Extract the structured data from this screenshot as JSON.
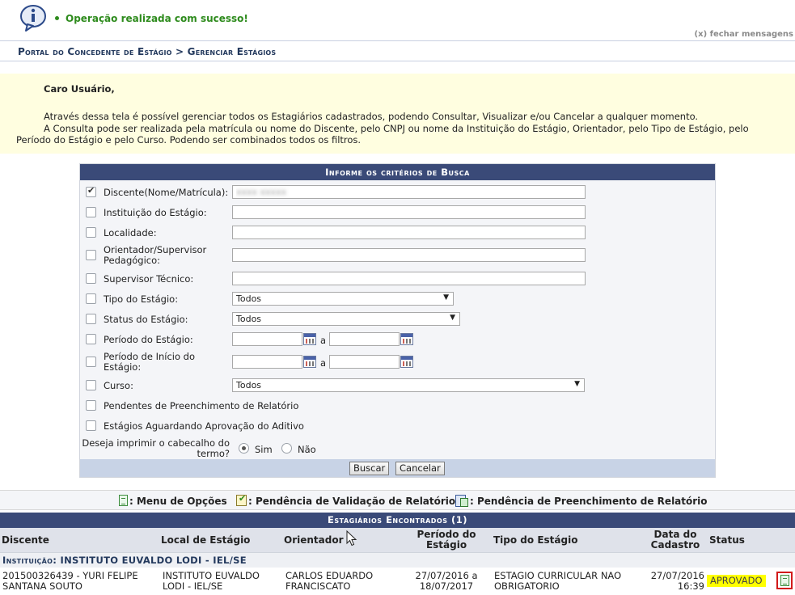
{
  "message": {
    "text": "Operação realizada com sucesso!",
    "close_label": "(x) fechar mensagens"
  },
  "breadcrumb": "Portal do Concedente de Estágio > Gerenciar Estágios",
  "notice": {
    "greeting": "Caro Usuário,",
    "paragraph1": "Através dessa tela é possível gerenciar todos os Estagiários cadastrados, podendo Consultar, Visualizar e/ou Cancelar a qualquer momento.",
    "paragraph2": "A Consulta pode ser realizada pela matrícula ou nome do Discente, pelo CNPJ ou nome da Instituição do Estágio, Orientador, pelo Tipo de Estágio, pelo Período do Estágio e pelo Curso. Podendo ser combinados todos os filtros."
  },
  "form": {
    "title": "Informe os critérios de Busca",
    "fields": {
      "discente": {
        "label": "Discente(Nome/Matrícula):",
        "value": "xxxx xxxxx",
        "checked": true
      },
      "instituicao": {
        "label": "Instituição do Estágio:",
        "value": ""
      },
      "localidade": {
        "label": "Localidade:",
        "value": ""
      },
      "orientador": {
        "label": "Orientador/Supervisor Pedagógico:",
        "value": ""
      },
      "supervisor": {
        "label": "Supervisor Técnico:",
        "value": ""
      },
      "tipo": {
        "label": "Tipo do Estágio:",
        "value": "Todos"
      },
      "status": {
        "label": "Status do Estágio:",
        "value": "Todos"
      },
      "periodo": {
        "label": "Período do Estágio:",
        "sep": "a"
      },
      "periodo_inicio": {
        "label": "Período de Início do Estágio:",
        "sep": "a"
      },
      "curso": {
        "label": "Curso:",
        "value": "Todos"
      },
      "pendentes": {
        "label": "Pendentes de Preenchimento de Relatório"
      },
      "aditivo": {
        "label": "Estágios Aguardando Aprovação do Aditivo"
      }
    },
    "print_header": {
      "label": "Deseja imprimir o cabecalho do termo?",
      "option_yes": "Sim",
      "option_no": "Não"
    },
    "search_button": "Buscar",
    "cancel_button": "Cancelar"
  },
  "legend": {
    "menu": ": Menu de Opções",
    "validacao": ": Pendência de Validação de Relatório",
    "preenchimento": ": Pendência de Preenchimento de Relatório"
  },
  "results": {
    "title": "Estagiários Encontrados (1)",
    "columns": {
      "discente": "Discente",
      "local": "Local de Estágio",
      "orientador": "Orientador",
      "periodo": "Período do Estágio",
      "tipo": "Tipo do Estágio",
      "data": "Data do Cadastro",
      "status": "Status"
    },
    "institution_prefix": "Instituição:",
    "institution_name": "INSTITUTO EUVALDO LODI - IEL/SE",
    "rows": [
      {
        "discente_line1": "201500326439 - YURI FELIPE",
        "discente_line2": "SANTANA SOUTO",
        "local_line1": "INSTITUTO EUVALDO",
        "local_line2": "LODI - IEL/SE",
        "orientador_line1": "CARLOS EDUARDO",
        "orientador_line2": "FRANCISCATO",
        "periodo_line1": "27/07/2016 a",
        "periodo_line2": "18/07/2017",
        "tipo_line1": "ESTAGIO CURRICULAR NAO",
        "tipo_line2": "OBRIGATORIO",
        "data_line1": "27/07/2016",
        "data_line2": "16:39",
        "status": "APROVADO"
      }
    ]
  },
  "colors": {
    "header_bg": "#3a4a78",
    "success": "#2e8b1d",
    "notice_bg": "#fffee0",
    "status_badge": "#ffff00"
  }
}
